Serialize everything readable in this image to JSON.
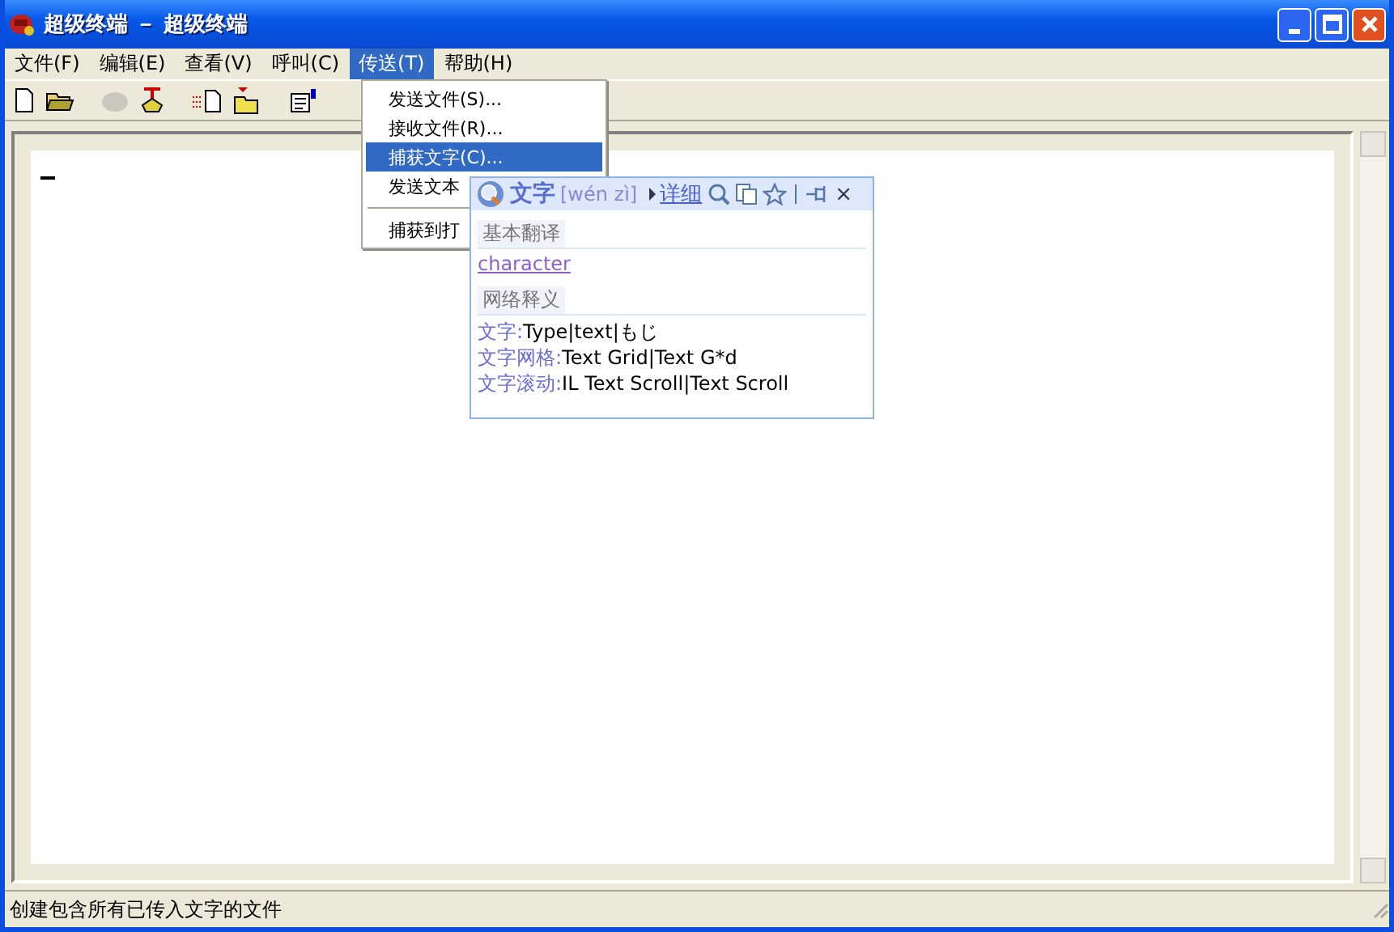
{
  "window": {
    "title": "超级终端 － 超级终端"
  },
  "menu": [
    {
      "label": "文件(F)",
      "selected": false
    },
    {
      "label": "编辑(E)",
      "selected": false
    },
    {
      "label": "查看(V)",
      "selected": false
    },
    {
      "label": "呼叫(C)",
      "selected": false
    },
    {
      "label": "传送(T)",
      "selected": true
    },
    {
      "label": "帮助(H)",
      "selected": false
    }
  ],
  "toolbar": [
    {
      "kind": "new"
    },
    {
      "kind": "open"
    },
    {
      "kind": "sep"
    },
    {
      "kind": "phone",
      "disabled": true
    },
    {
      "kind": "hangup"
    },
    {
      "kind": "sep"
    },
    {
      "kind": "send"
    },
    {
      "kind": "receive"
    },
    {
      "kind": "sep"
    },
    {
      "kind": "properties"
    }
  ],
  "dropdown": [
    {
      "kind": "item",
      "label": "发送文件(S)...",
      "selected": false
    },
    {
      "kind": "item",
      "label": "接收文件(R)...",
      "selected": false
    },
    {
      "kind": "item",
      "label": "捕获文字(C)...",
      "selected": true
    },
    {
      "kind": "item",
      "label": "发送文本",
      "selected": false
    },
    {
      "kind": "separator"
    },
    {
      "kind": "item",
      "label": "捕获到打",
      "selected": false
    }
  ],
  "dictionary_popup": {
    "word": "文字",
    "pinyin": "[wén zì]",
    "details_link": "详细",
    "close": "×",
    "sections": [
      {
        "heading": "基本翻译",
        "kind": "links",
        "entries": [
          {
            "text": "character"
          }
        ]
      },
      {
        "heading": "网络释义",
        "kind": "pairs",
        "entries": [
          {
            "term": "文字:",
            "text": "Type|text|もじ"
          },
          {
            "term": "文字网格:",
            "text": "Text Grid|Text G*d"
          },
          {
            "term": "文字滚动:",
            "text": "IL Text Scroll|Text Scroll"
          }
        ]
      }
    ]
  },
  "status_bar": "创建包含所有已传入文字的文件"
}
